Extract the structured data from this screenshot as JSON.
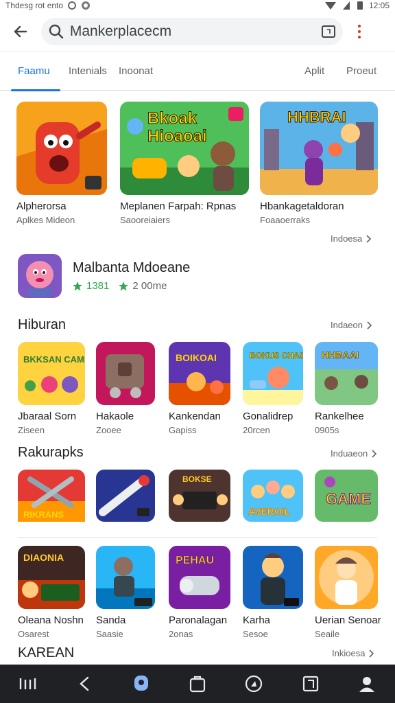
{
  "status_bar": {
    "left_text": "Thdesg rot ento",
    "right_text": "12:05"
  },
  "search": {
    "value": "Mankerplacecm"
  },
  "tabs": [
    {
      "label": "Faamu",
      "active": true
    },
    {
      "label": "Intenials"
    },
    {
      "label": "Inoonat"
    },
    {
      "label": "Aplit"
    },
    {
      "label": "Proeut"
    }
  ],
  "featured": [
    {
      "title": "Alpherorsa",
      "subtitle": "Aplkes Mideon"
    },
    {
      "title": "Meplanen Farpah: Rpnas",
      "subtitle": "Saooreiaiers"
    },
    {
      "title": "Hbankagetaldoran",
      "subtitle": "Foaaoerraks"
    }
  ],
  "more_label_top": "Indoesa",
  "promo": {
    "title": "Malbanta Mdoeane",
    "meta1": "1381",
    "meta2": "2 00me"
  },
  "sections": [
    {
      "title": "Hiburan",
      "more": "Indaeon",
      "items": [
        {
          "title": "Jbaraal Sorn",
          "subtitle": "Ziseen"
        },
        {
          "title": "Hakaole",
          "subtitle": "Zooee"
        },
        {
          "title": "Kankendan",
          "subtitle": "Gapiss"
        },
        {
          "title": "Gonalidrep",
          "subtitle": "20rcen"
        },
        {
          "title": "Rankelhee",
          "subtitle": "0905s"
        }
      ]
    },
    {
      "title": "Rakurapks",
      "more": "Induaeon",
      "items": [
        {
          "title": "",
          "subtitle": ""
        },
        {
          "title": "",
          "subtitle": ""
        },
        {
          "title": "",
          "subtitle": ""
        },
        {
          "title": "",
          "subtitle": ""
        },
        {
          "title": "",
          "subtitle": ""
        }
      ]
    },
    {
      "title": "",
      "more": "",
      "items": [
        {
          "title": "Oleana Noshn",
          "subtitle": "Osarest"
        },
        {
          "title": "Sanda",
          "subtitle": "Saasie"
        },
        {
          "title": "Paronalagan",
          "subtitle": "2onas"
        },
        {
          "title": "Karha",
          "subtitle": "Sesoe"
        },
        {
          "title": "Uerian Senoar",
          "subtitle": "Seaile"
        }
      ]
    }
  ],
  "bottom_section_title": "KAREAN",
  "bottom_section_more": "Inkioesa",
  "thumb_texts": {
    "f1": "",
    "f2_l1": "Bkoak",
    "f2_l2": "Hioaoai",
    "f3_l1": "HHBRAI",
    "s1": "BKKSAN CAMB",
    "s3": "BOIKOAI",
    "s4": "BOKUS CHAS",
    "s5": "HHBAAI",
    "r1": "RIKRANS",
    "r3": "BOKSE",
    "r4": "AVEROIL",
    "r5": "GAME",
    "b1": "DIAONIA",
    "b3": "PEHAU"
  },
  "colors": {
    "accent": "#1a73e8",
    "navbar": "#202124"
  }
}
